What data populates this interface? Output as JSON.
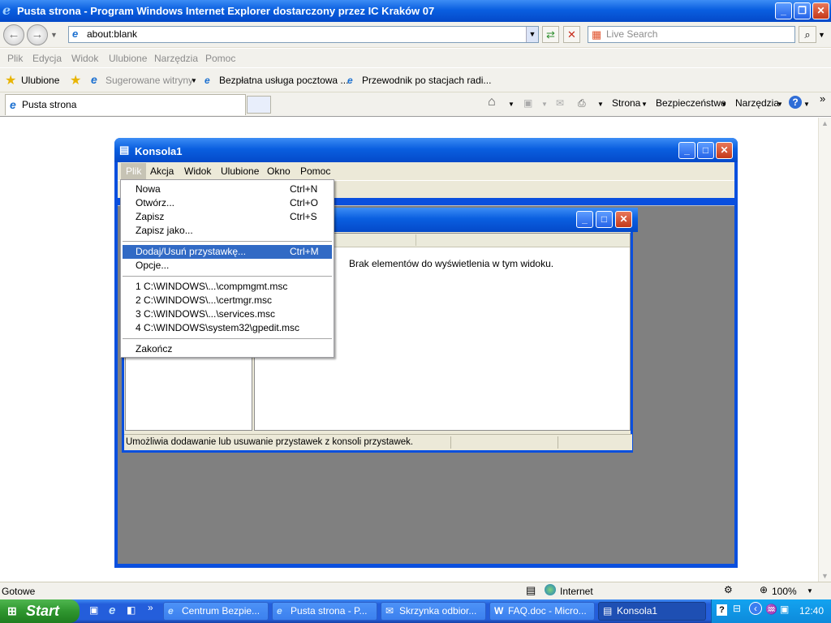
{
  "ie": {
    "title": "Pusta strona - Program Windows Internet Explorer dostarczony przez IC Kraków 07",
    "address": "about:blank",
    "search_placeholder": "Live Search",
    "menu": [
      "Plik",
      "Edycja",
      "Widok",
      "Ulubione",
      "Narzędzia",
      "Pomoc"
    ],
    "favorites_label": "Ulubione",
    "fav_links": [
      "Sugerowane witryny",
      "Bezpłatna usługa pocztowa ...",
      "Przewodnik po stacjach radi..."
    ],
    "tab_title": "Pusta strona",
    "commands": [
      "Strona",
      "Bezpieczeństwo",
      "Narzędzia"
    ],
    "status_text": "Gotowe",
    "zone": "Internet",
    "zoom": "100%"
  },
  "mmc": {
    "title": "Konsola1",
    "menu": [
      "Plik",
      "Akcja",
      "Widok",
      "Ulubione",
      "Okno",
      "Pomoc"
    ],
    "empty_message": "Brak elementów do wyświetlenia w tym widoku.",
    "status": "Umożliwia dodawanie lub usuwanie przystawek z konsoli przystawek."
  },
  "file_menu": {
    "items": [
      {
        "label": "Nowa",
        "shortcut": "Ctrl+N"
      },
      {
        "label": "Otwórz...",
        "shortcut": "Ctrl+O"
      },
      {
        "label": "Zapisz",
        "shortcut": "Ctrl+S"
      },
      {
        "label": "Zapisz jako...",
        "shortcut": ""
      },
      {
        "label": "Dodaj/Usuń przystawkę...",
        "shortcut": "Ctrl+M"
      },
      {
        "label": "Opcje...",
        "shortcut": ""
      },
      {
        "label": "1 C:\\WINDOWS\\...\\compmgmt.msc",
        "shortcut": ""
      },
      {
        "label": "2 C:\\WINDOWS\\...\\certmgr.msc",
        "shortcut": ""
      },
      {
        "label": "3 C:\\WINDOWS\\...\\services.msc",
        "shortcut": ""
      },
      {
        "label": "4 C:\\WINDOWS\\system32\\gpedit.msc",
        "shortcut": ""
      },
      {
        "label": "Zakończ",
        "shortcut": ""
      }
    ]
  },
  "taskbar": {
    "start": "Start",
    "tasks": [
      "Centrum Bezpie...",
      "Pusta strona - P...",
      "Skrzynka odbior...",
      "FAQ.doc - Micro...",
      "Konsola1"
    ],
    "clock": "12:40"
  },
  "colors": {
    "xp_blue": "#0a5fe0",
    "highlight": "#316ac5",
    "taskbar": "#245edb",
    "start_green": "#2f962f"
  }
}
